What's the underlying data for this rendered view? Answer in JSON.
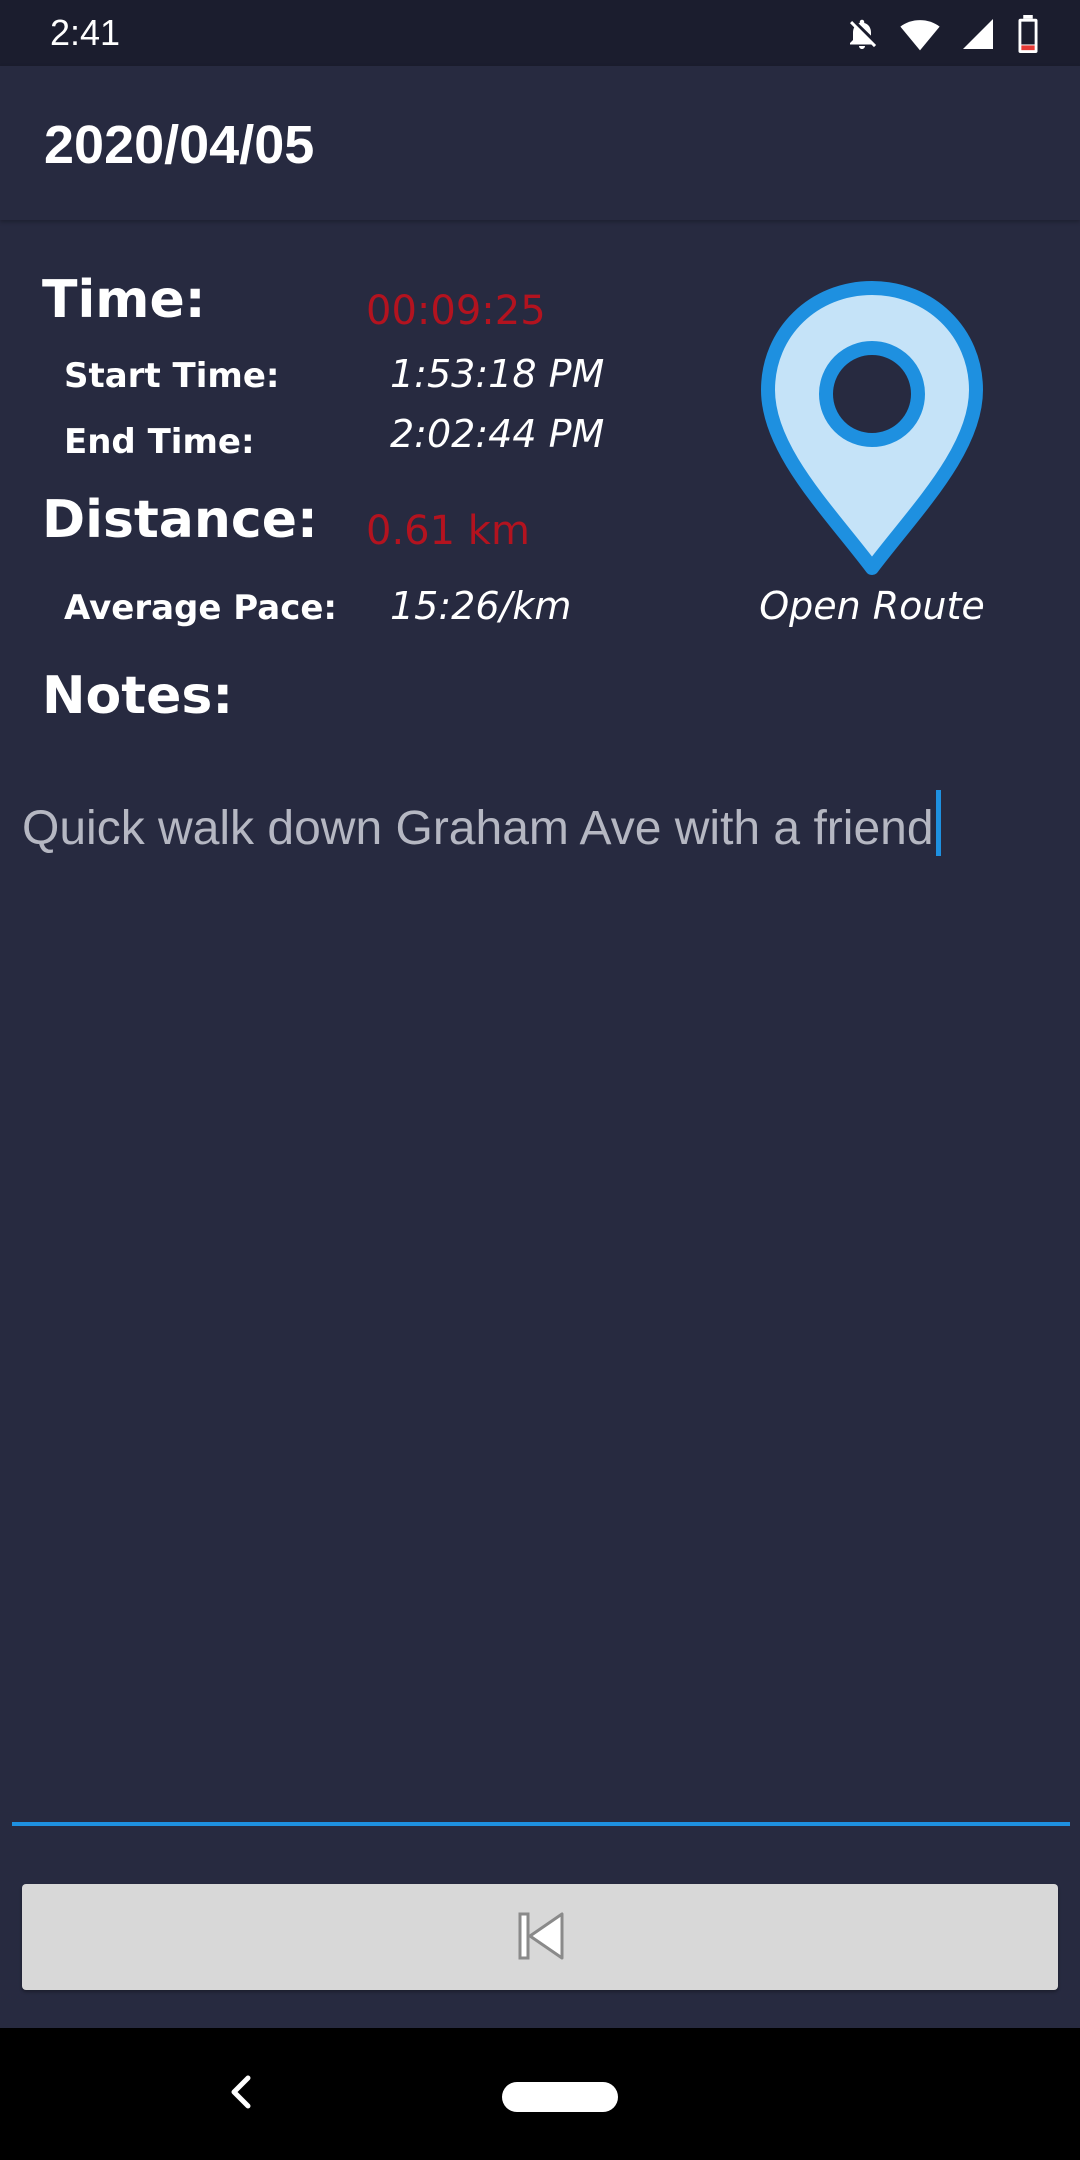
{
  "status_bar": {
    "time": "2:41",
    "icons": [
      "notifications-off-icon",
      "wifi-icon",
      "cell-signal-icon",
      "battery-icon"
    ]
  },
  "app_bar": {
    "title": "2020/04/05"
  },
  "details": {
    "time_label": "Time:",
    "time_value": "00:09:25",
    "start_time_label": "Start Time:",
    "start_time_value": "1:53:18 PM",
    "end_time_label": "End Time:",
    "end_time_value": "2:02:44 PM",
    "distance_label": "Distance:",
    "distance_value": "0.61 km",
    "average_pace_label": "Average Pace:",
    "average_pace_value": "15:26/km",
    "notes_label": "Notes:"
  },
  "route": {
    "icon": "map-pin-icon",
    "label": "Open Route"
  },
  "notes": {
    "value": "Quick walk down Graham Ave with a friend"
  },
  "actions": {
    "back_icon": "skip-previous-icon"
  },
  "colors": {
    "background": "#272A40",
    "accent": "#1E90E0",
    "value_red": "#B3131F",
    "pin_fill": "#C5E3F8"
  }
}
